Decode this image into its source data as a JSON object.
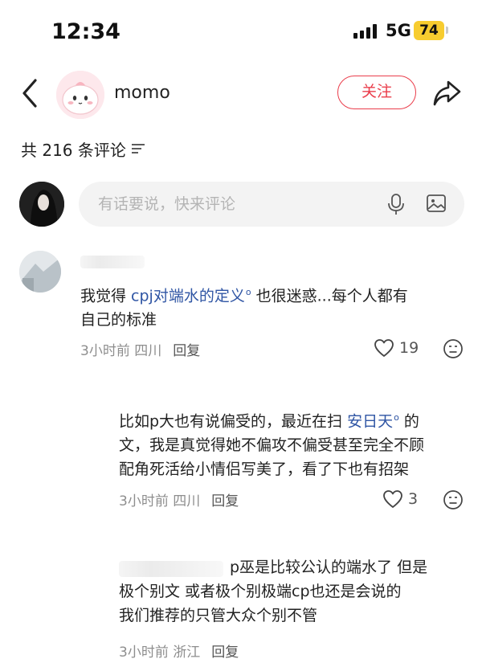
{
  "status_bar": {
    "time": "12:34",
    "network": "5G",
    "battery": "74"
  },
  "header": {
    "username": "momo",
    "follow_label": "关注"
  },
  "comments_header": {
    "count_text": "共 216 条评论"
  },
  "comment_input": {
    "placeholder": "有话要说，快来评论"
  },
  "comments": [
    {
      "text_before": "我觉得 ",
      "link": "cpj对端水的定义",
      "text_after_line1": " 也很迷惑...每个人都有",
      "text_line2": "自己的标准",
      "time": "3小时前",
      "location": "四川",
      "reply_label": "回复",
      "likes": "19"
    },
    {
      "line1_before": "比如p大也有说偏受的，最近在扫 ",
      "link": "安日天",
      "line1_after": " 的",
      "line2": "文，我是真觉得她不偏攻不偏受甚至完全不顾",
      "line3": "配角死活给小情侣写美了，看了下也有招架",
      "time": "3小时前",
      "location": "四川",
      "reply_label": "回复",
      "likes": "3"
    },
    {
      "line1": "p巫是比较公认的端水了  但是",
      "line2": "极个别文 或者极个别极端cp也还是会说的",
      "line3": "我们推荐的只管大众个别不管",
      "time": "3小时前",
      "location": "浙江",
      "reply_label": "回复"
    }
  ]
}
